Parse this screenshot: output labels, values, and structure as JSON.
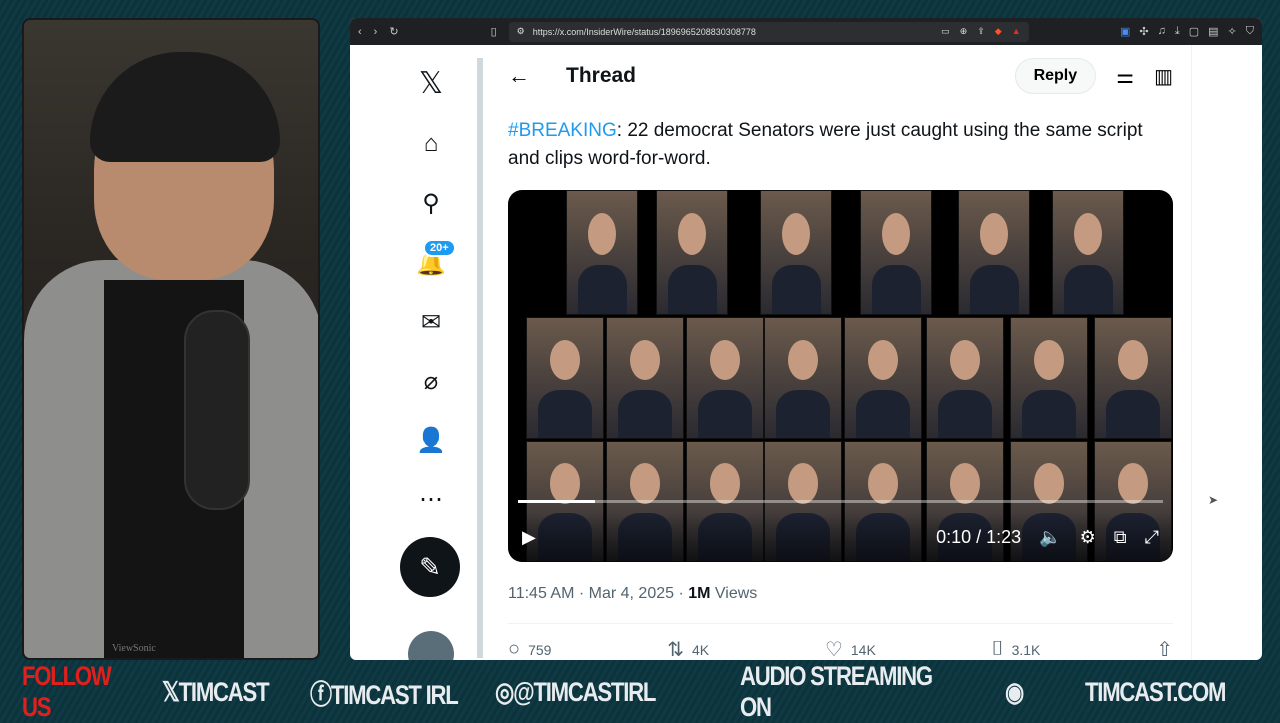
{
  "webcam": {
    "monitor_brand": "ViewSonic"
  },
  "browser": {
    "url": "https://x.com/InsiderWire/status/1896965208830308778"
  },
  "sidebar": {
    "items": [
      {
        "name": "x-logo",
        "glyph": "𝕏"
      },
      {
        "name": "home",
        "glyph": "⌂"
      },
      {
        "name": "search",
        "glyph": "⚲"
      },
      {
        "name": "notifications",
        "glyph": "🔔",
        "badge": "20+"
      },
      {
        "name": "messages",
        "glyph": "✉"
      },
      {
        "name": "grok",
        "glyph": "⌀"
      },
      {
        "name": "profile",
        "glyph": "👤"
      },
      {
        "name": "more",
        "glyph": "⋯"
      }
    ],
    "compose_glyph": "✎"
  },
  "header": {
    "title": "Thread",
    "reply_label": "Reply"
  },
  "tweet": {
    "hashtag": "#BREAKING",
    "text": ": 22 democrat Senators were just caught using the same script and clips word-for-word.",
    "time": "11:45 AM · Mar 4, 2025 · ",
    "views_count": "1M",
    "views_label": " Views",
    "replies": "759",
    "reposts": "4K",
    "likes": "14K",
    "bookmarks": "3.1K"
  },
  "video": {
    "current_time": "0:10",
    "duration": "1:23",
    "time_display": "0:10 / 1:23",
    "progress": 0.12
  },
  "footer": {
    "follow": "FOLLOW US",
    "x": "𝕏TIMCAST",
    "fb": "ⓕTIMCAST IRL",
    "ig": "◎@TIMCASTIRL",
    "audio": "AUDIO STREAMING ON",
    "site": "TIMCAST.COM"
  },
  "colors": {
    "accent": "#1d9bf0",
    "follow_red": "#e0201c"
  }
}
